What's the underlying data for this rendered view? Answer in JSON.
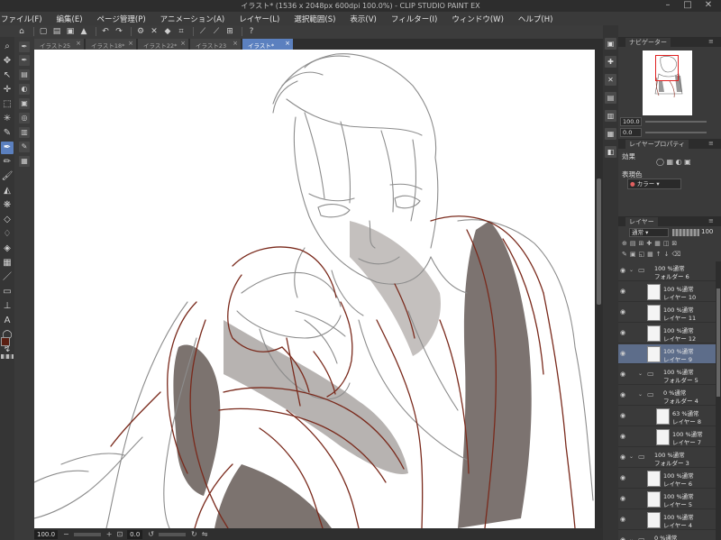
{
  "titlebar": {
    "title": "イラスト* (1536 x 2048px 600dpi 100.0%)  - CLIP STUDIO PAINT EX",
    "minimize_icon": "minimize-icon",
    "maximize_icon": "maximize-icon",
    "close_icon": "close-icon"
  },
  "menubar": {
    "items": [
      "ファイル(F)",
      "編集(E)",
      "ページ管理(P)",
      "アニメーション(A)",
      "レイヤー(L)",
      "選択範囲(S)",
      "表示(V)",
      "フィルター(I)",
      "ウィンドウ(W)",
      "ヘルプ(H)"
    ]
  },
  "tabs": [
    {
      "label": "イラスト25"
    },
    {
      "label": "イラスト18*"
    },
    {
      "label": "イラスト22*"
    },
    {
      "label": "イラスト23"
    },
    {
      "label": "イラスト*",
      "active": true
    }
  ],
  "statusbar": {
    "zoom": "100.0",
    "angle": "0.0"
  },
  "navigator": {
    "title": "ナビゲーター",
    "zoom": "100.0",
    "angle": "0.0"
  },
  "layer_property": {
    "title": "レイヤープロパティ",
    "effect_label": "効果",
    "expression_label": "表現色",
    "expression_value": "カラー"
  },
  "layer_panel": {
    "title": "レイヤー",
    "blend_mode": "通常",
    "opacity": "100",
    "layers": [
      {
        "l1": "100 %通常",
        "l2": "フォルダー 6",
        "kind": "folder",
        "indent": 0
      },
      {
        "l1": "100 %通常",
        "l2": "レイヤー 10",
        "kind": "layer",
        "indent": 1
      },
      {
        "l1": "100 %通常",
        "l2": "レイヤー 11",
        "kind": "layer",
        "indent": 1
      },
      {
        "l1": "100 %通常",
        "l2": "レイヤー 12",
        "kind": "layer",
        "indent": 1
      },
      {
        "l1": "100 %通常",
        "l2": "レイヤー 9",
        "kind": "layer",
        "indent": 1,
        "selected": true
      },
      {
        "l1": "100 %通常",
        "l2": "フォルダー 5",
        "kind": "folder",
        "indent": 1
      },
      {
        "l1": "0 %通常",
        "l2": "フォルダー 4",
        "kind": "folder",
        "indent": 1
      },
      {
        "l1": "63 %通常",
        "l2": "レイヤー 8",
        "kind": "layer",
        "indent": 2
      },
      {
        "l1": "100 %通常",
        "l2": "レイヤー 7",
        "kind": "layer",
        "indent": 2
      },
      {
        "l1": "100 %通常",
        "l2": "フォルダー 3",
        "kind": "folder",
        "indent": 0
      },
      {
        "l1": "100 %通常",
        "l2": "レイヤー 6",
        "kind": "layer",
        "indent": 1
      },
      {
        "l1": "100 %通常",
        "l2": "レイヤー 5",
        "kind": "layer",
        "indent": 1
      },
      {
        "l1": "100 %通常",
        "l2": "レイヤー 4",
        "kind": "layer",
        "indent": 1
      },
      {
        "l1": "0 %通常",
        "l2": "フォルダー 2",
        "kind": "folder",
        "indent": 0
      }
    ]
  },
  "colors": {
    "accent": "#5b80bf",
    "sketch_gray": "#8c8c8c",
    "sketch_red": "#7a2a1c",
    "shadow": "#6e6460"
  }
}
